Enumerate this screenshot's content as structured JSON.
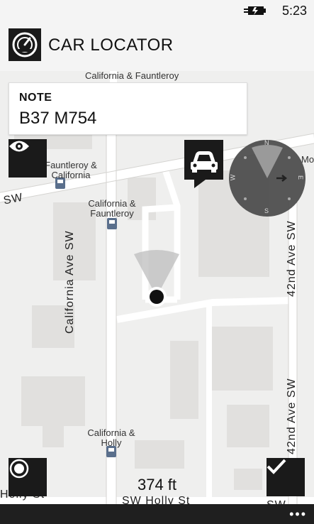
{
  "status": {
    "time": "5:23",
    "battery_icon": "battery-charging-icon"
  },
  "header": {
    "title": "CAR LOCATOR",
    "icon": "speedometer-icon"
  },
  "note": {
    "label": "NOTE",
    "value": "B37 M754"
  },
  "map": {
    "labels": {
      "fauntleroy_california": "Fauntleroy & California",
      "california_fauntleroy": "California & Fauntleroy",
      "california_holly": "California & Holly",
      "california_top": "California & Fauntleroy",
      "mo": "Mo"
    },
    "streets": {
      "california_ave": "California Ave SW",
      "fortysecond_upper": "42nd Ave SW",
      "fortysecond_lower": "42nd Ave SW",
      "sw_left": "SW",
      "holly_st": "SW Holly St",
      "holly_left": "Holly St",
      "sw_bottom_right": "SW"
    },
    "compass": {
      "n": "N",
      "s": "S",
      "e": "E",
      "w": "W"
    }
  },
  "distance": "374 ft",
  "buttons": {
    "view": "eye-icon",
    "car": "car-icon",
    "record": "record-icon",
    "confirm": "checkmark-icon",
    "more": "•••"
  },
  "colors": {
    "dark": "#1a1a1a",
    "map_bg": "#efefee",
    "road": "#ffffff",
    "block": "#e1e0de"
  }
}
